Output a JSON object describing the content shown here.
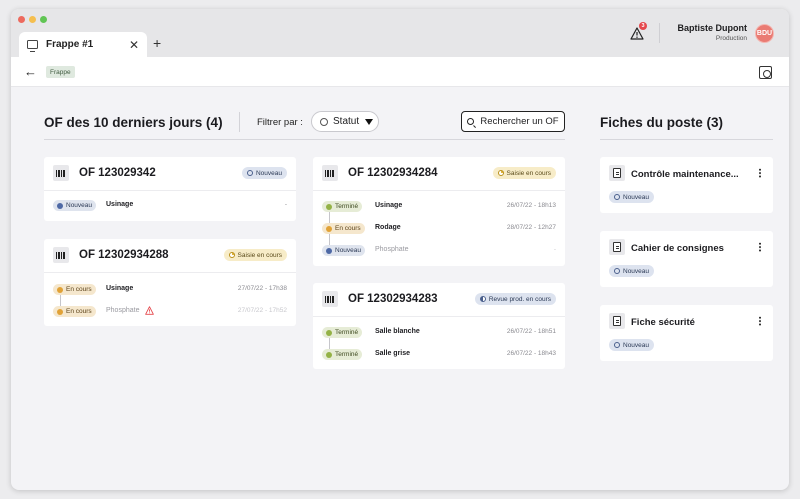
{
  "tab": {
    "title": "Frappe #1",
    "close": "✕",
    "add": "+"
  },
  "header": {
    "alert_count": "3",
    "user_name": "Baptiste Dupont",
    "user_role": "Production",
    "avatar": "BDU"
  },
  "toolbar": {
    "back": "←",
    "breadcrumb": "Frappe"
  },
  "main": {
    "title": "OF des 10 derniers jours (4)",
    "filter_label": "Filtrer par :",
    "status_filter": "Statut",
    "search_label": "Rechercher un OF"
  },
  "side": {
    "title": "Fiches du poste (3)"
  },
  "ofs": [
    {
      "title": "OF 123029342",
      "status": "Nouveau",
      "steps": [
        {
          "status": "Nouveau",
          "op": "Usinage",
          "date": "-"
        }
      ]
    },
    {
      "title": "OF 12302934288",
      "status": "Saisie en cours",
      "steps": [
        {
          "status": "En cours",
          "op": "Usinage",
          "date": "27/07/22 - 17h38"
        },
        {
          "status": "En cours",
          "op": "Phosphate",
          "date": "27/07/22 - 17h52"
        }
      ]
    },
    {
      "title": "OF 12302934284",
      "status": "Saisie en cours",
      "steps": [
        {
          "status": "Terminé",
          "op": "Usinage",
          "date": "26/07/22 - 18h13"
        },
        {
          "status": "En cours",
          "op": "Rodage",
          "date": "28/07/22 - 12h27"
        },
        {
          "status": "Nouveau",
          "op": "Phosphate",
          "date": "-"
        }
      ]
    },
    {
      "title": "OF 12302934283",
      "status": "Revue prod. en cours",
      "steps": [
        {
          "status": "Terminé",
          "op": "Salle blanche",
          "date": "26/07/22 - 18h51"
        },
        {
          "status": "Terminé",
          "op": "Salle grise",
          "date": "26/07/22 - 18h43"
        }
      ]
    }
  ],
  "fiches": [
    {
      "title": "Contrôle maintenance...",
      "status": "Nouveau"
    },
    {
      "title": "Cahier de consignes",
      "status": "Nouveau"
    },
    {
      "title": "Fiche sécurité",
      "status": "Nouveau"
    }
  ],
  "colors": {
    "terminated": "#94b246",
    "in_progress": "#e1a237",
    "new": "#4e69a5",
    "alert": "#e5484d"
  },
  "icons": [
    "monitor-icon",
    "close-icon",
    "plus-icon",
    "warning-icon",
    "back-arrow-icon",
    "info-icon",
    "status-circle-icon",
    "caret-down-icon",
    "search-icon",
    "barcode-icon",
    "document-icon",
    "kebab-menu-icon"
  ]
}
